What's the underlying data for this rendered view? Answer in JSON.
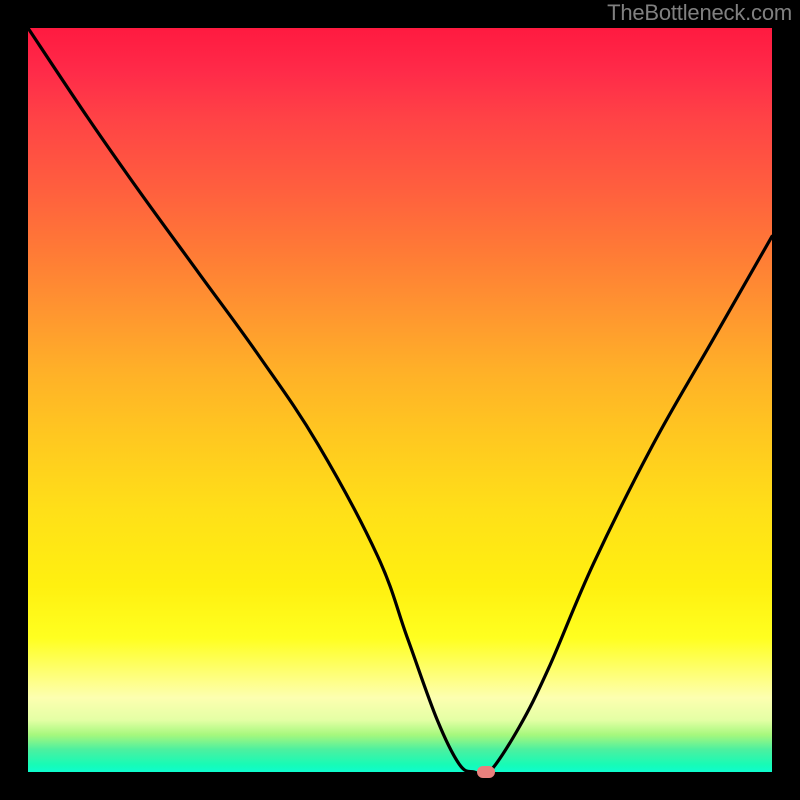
{
  "watermark": "TheBottleneck.com",
  "chart_data": {
    "type": "line",
    "title": "",
    "xlabel": "",
    "ylabel": "",
    "xlim": [
      0,
      100
    ],
    "ylim": [
      0,
      100
    ],
    "grid": false,
    "legend": false,
    "series": [
      {
        "name": "bottleneck-curve",
        "x": [
          0,
          8,
          15,
          23,
          31,
          39,
          47,
          51,
          55,
          58,
          60,
          62,
          66,
          70,
          76,
          84,
          92,
          100
        ],
        "y": [
          100,
          88,
          78,
          67,
          56,
          44,
          29,
          18,
          7,
          1,
          0,
          0,
          6,
          14,
          28,
          44,
          58,
          72
        ]
      }
    ],
    "marker": {
      "x": 61.5,
      "y": 0,
      "color": "#e9807d"
    },
    "background_gradient": {
      "top": "#ff1a40",
      "mid": "#ffe018",
      "bottom": "#0efcce"
    }
  }
}
